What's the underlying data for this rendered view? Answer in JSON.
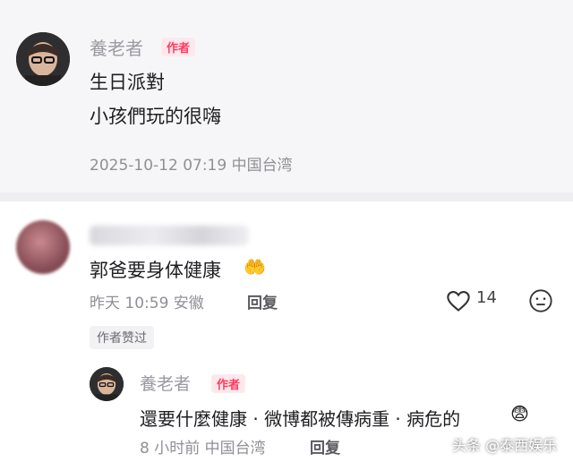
{
  "comment1": {
    "author": "養老者",
    "badge": "作者",
    "lines": [
      "生日派對",
      "小孩們玩的很嗨"
    ],
    "meta": "2025-10-12 07:19 中国台湾"
  },
  "comment2": {
    "text": "郭爸要身体健康",
    "emoji": "🤲",
    "time": "昨天 10:59 安徽",
    "reply_label": "回复",
    "likes": "14",
    "author_liked_chip": "作者赞过"
  },
  "reply1": {
    "author": "養老者",
    "badge": "作者",
    "text": "還要什麼健康 · 微博都被傳病重 · 病危的",
    "emoji": "😨",
    "meta": "8 小时前 中国台湾",
    "reply_label": "回复"
  },
  "watermark": "头条 @泰西娱乐"
}
